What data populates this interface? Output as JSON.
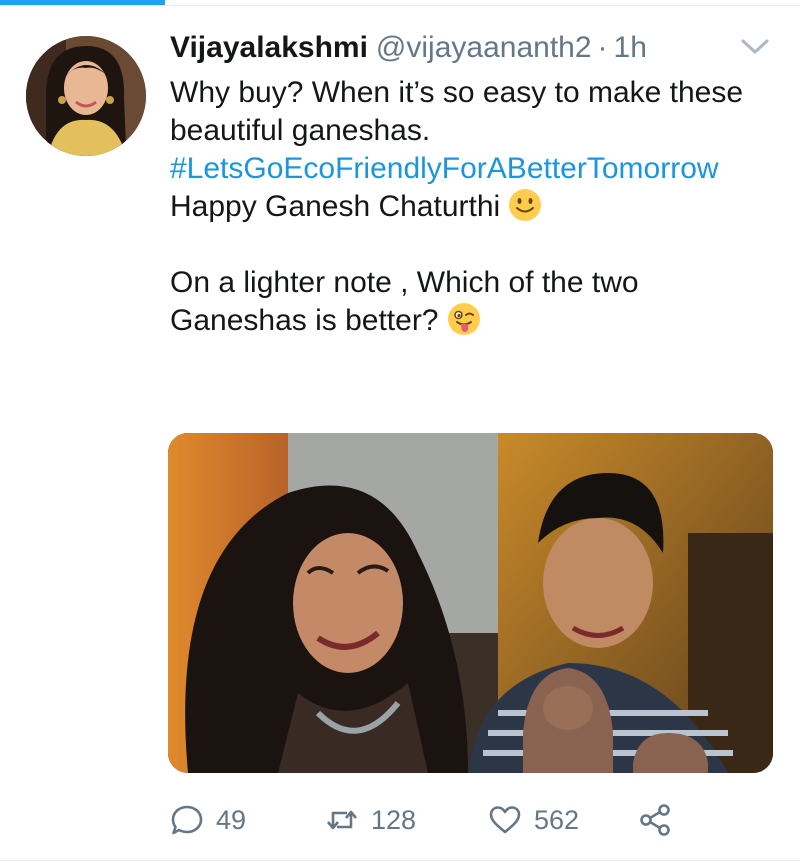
{
  "tweet": {
    "author_name": "Vijayalakshmi",
    "handle": "@vijayaananth2",
    "separator": "·",
    "time": "1h",
    "line1": "Why buy? When it’s so easy to make these beautiful ganeshas.",
    "hashtag": "#LetsGoEcoFriendlyForABetterTomorrow",
    "line2": "Happy Ganesh Chaturthi",
    "line3": "On a lighter note , Which of the two Ganeshas is better?",
    "emoji1": "slightly-smiling-face",
    "emoji2": "winking-face-with-tongue"
  },
  "actions": {
    "reply_count": "49",
    "retweet_count": "128",
    "like_count": "562"
  },
  "colors": {
    "accent": "#1da1f2",
    "hashtag": "#1b95e0",
    "muted": "#657786",
    "text": "#14171a"
  }
}
